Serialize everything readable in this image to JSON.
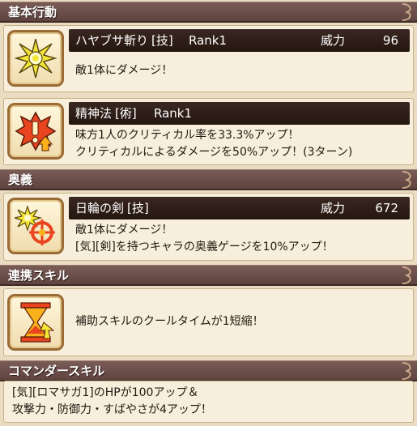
{
  "sections": {
    "basic": "基本行動",
    "ougi": "奥義",
    "renkei": "連携スキル",
    "commander": "コマンダースキル"
  },
  "skills": [
    {
      "name": "ハヤブサ斬り",
      "type": "[技]",
      "rank": "Rank1",
      "power_label": "威力",
      "power": "96",
      "desc": [
        "敵1体にダメージ！"
      ],
      "icon": "slash-burst-icon"
    },
    {
      "name": "精神法",
      "type": "[術]",
      "rank": "Rank1",
      "desc": [
        "味方1人のクリティカル率を33.3%アップ！",
        "クリティカルによるダメージを50%アップ！(3ターン)"
      ],
      "icon": "critical-up-icon"
    },
    {
      "name": "日輪の剣",
      "type": "[技]",
      "power_label": "威力",
      "power": "672",
      "desc": [
        "敵1体にダメージ！",
        "[気][剣]を持つキャラの奥義ゲージを10%アップ！"
      ],
      "icon": "sun-sword-icon"
    }
  ],
  "renkei": {
    "desc": "補助スキルのクールタイムが1短縮！",
    "icon": "hourglass-icon"
  },
  "commander": {
    "lines": [
      "[気][ロマサガ1]のHPが100アップ＆",
      "攻撃力・防御力・すばやさが4アップ！"
    ]
  }
}
